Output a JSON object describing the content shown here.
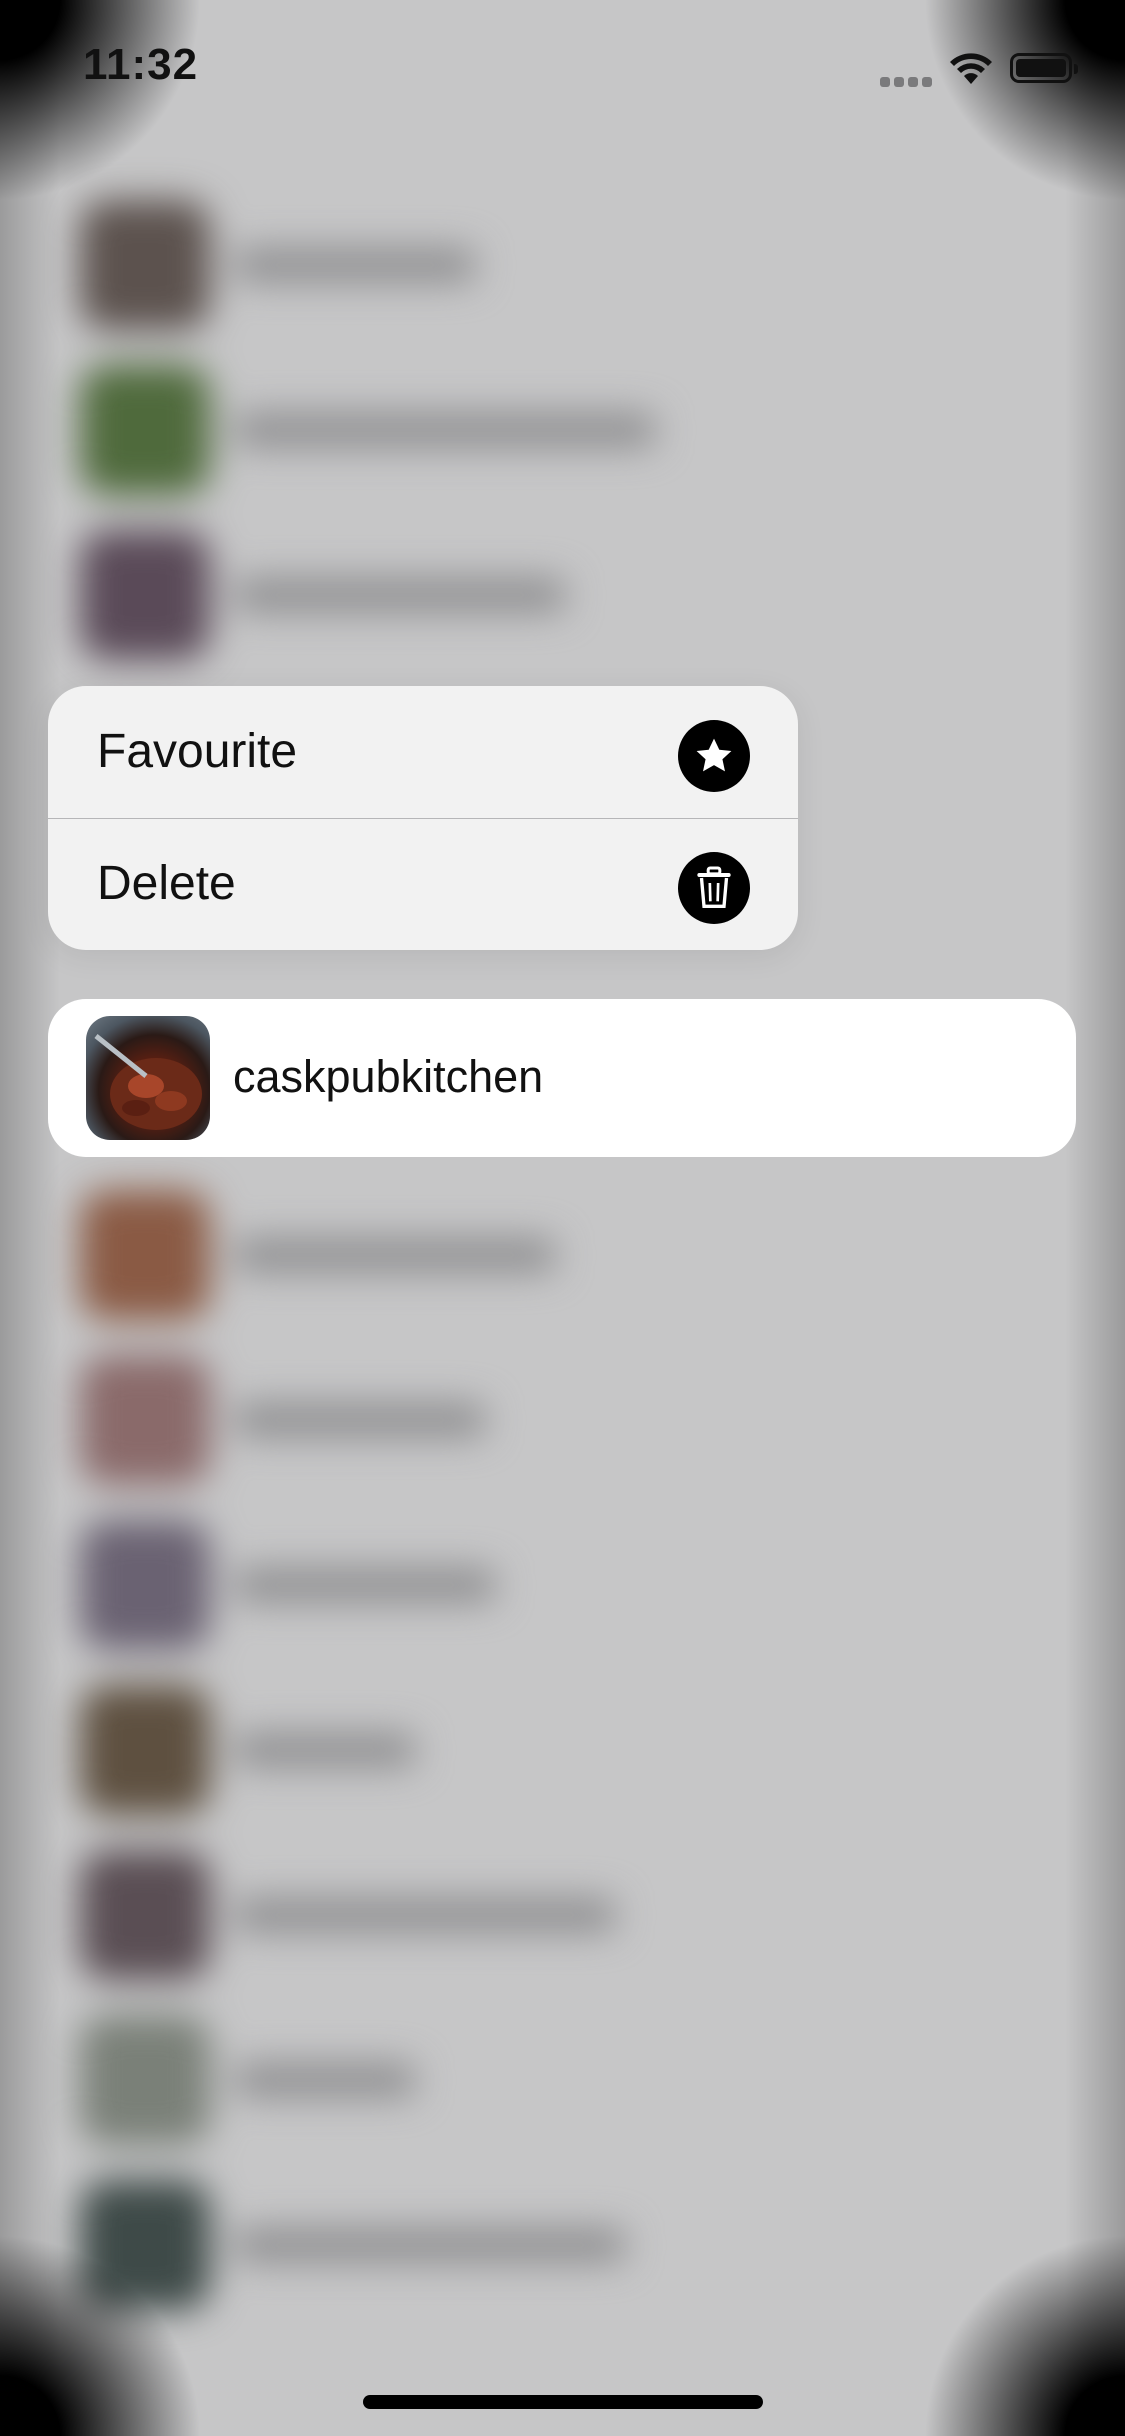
{
  "status_bar": {
    "time": "11:32"
  },
  "context_menu": {
    "items": [
      {
        "label": "Favourite",
        "icon": "star-icon"
      },
      {
        "label": "Delete",
        "icon": "trash-icon"
      }
    ]
  },
  "preview": {
    "name": "caskpubkitchen"
  },
  "background_thumb_colors": [
    "#5c524e",
    "#4f6a3c",
    "#5a4a58",
    "#8a5a44",
    "#8a6a6a",
    "#6a6272",
    "#5e5040",
    "#5a4e54",
    "#7a8078",
    "#3e4a48"
  ]
}
